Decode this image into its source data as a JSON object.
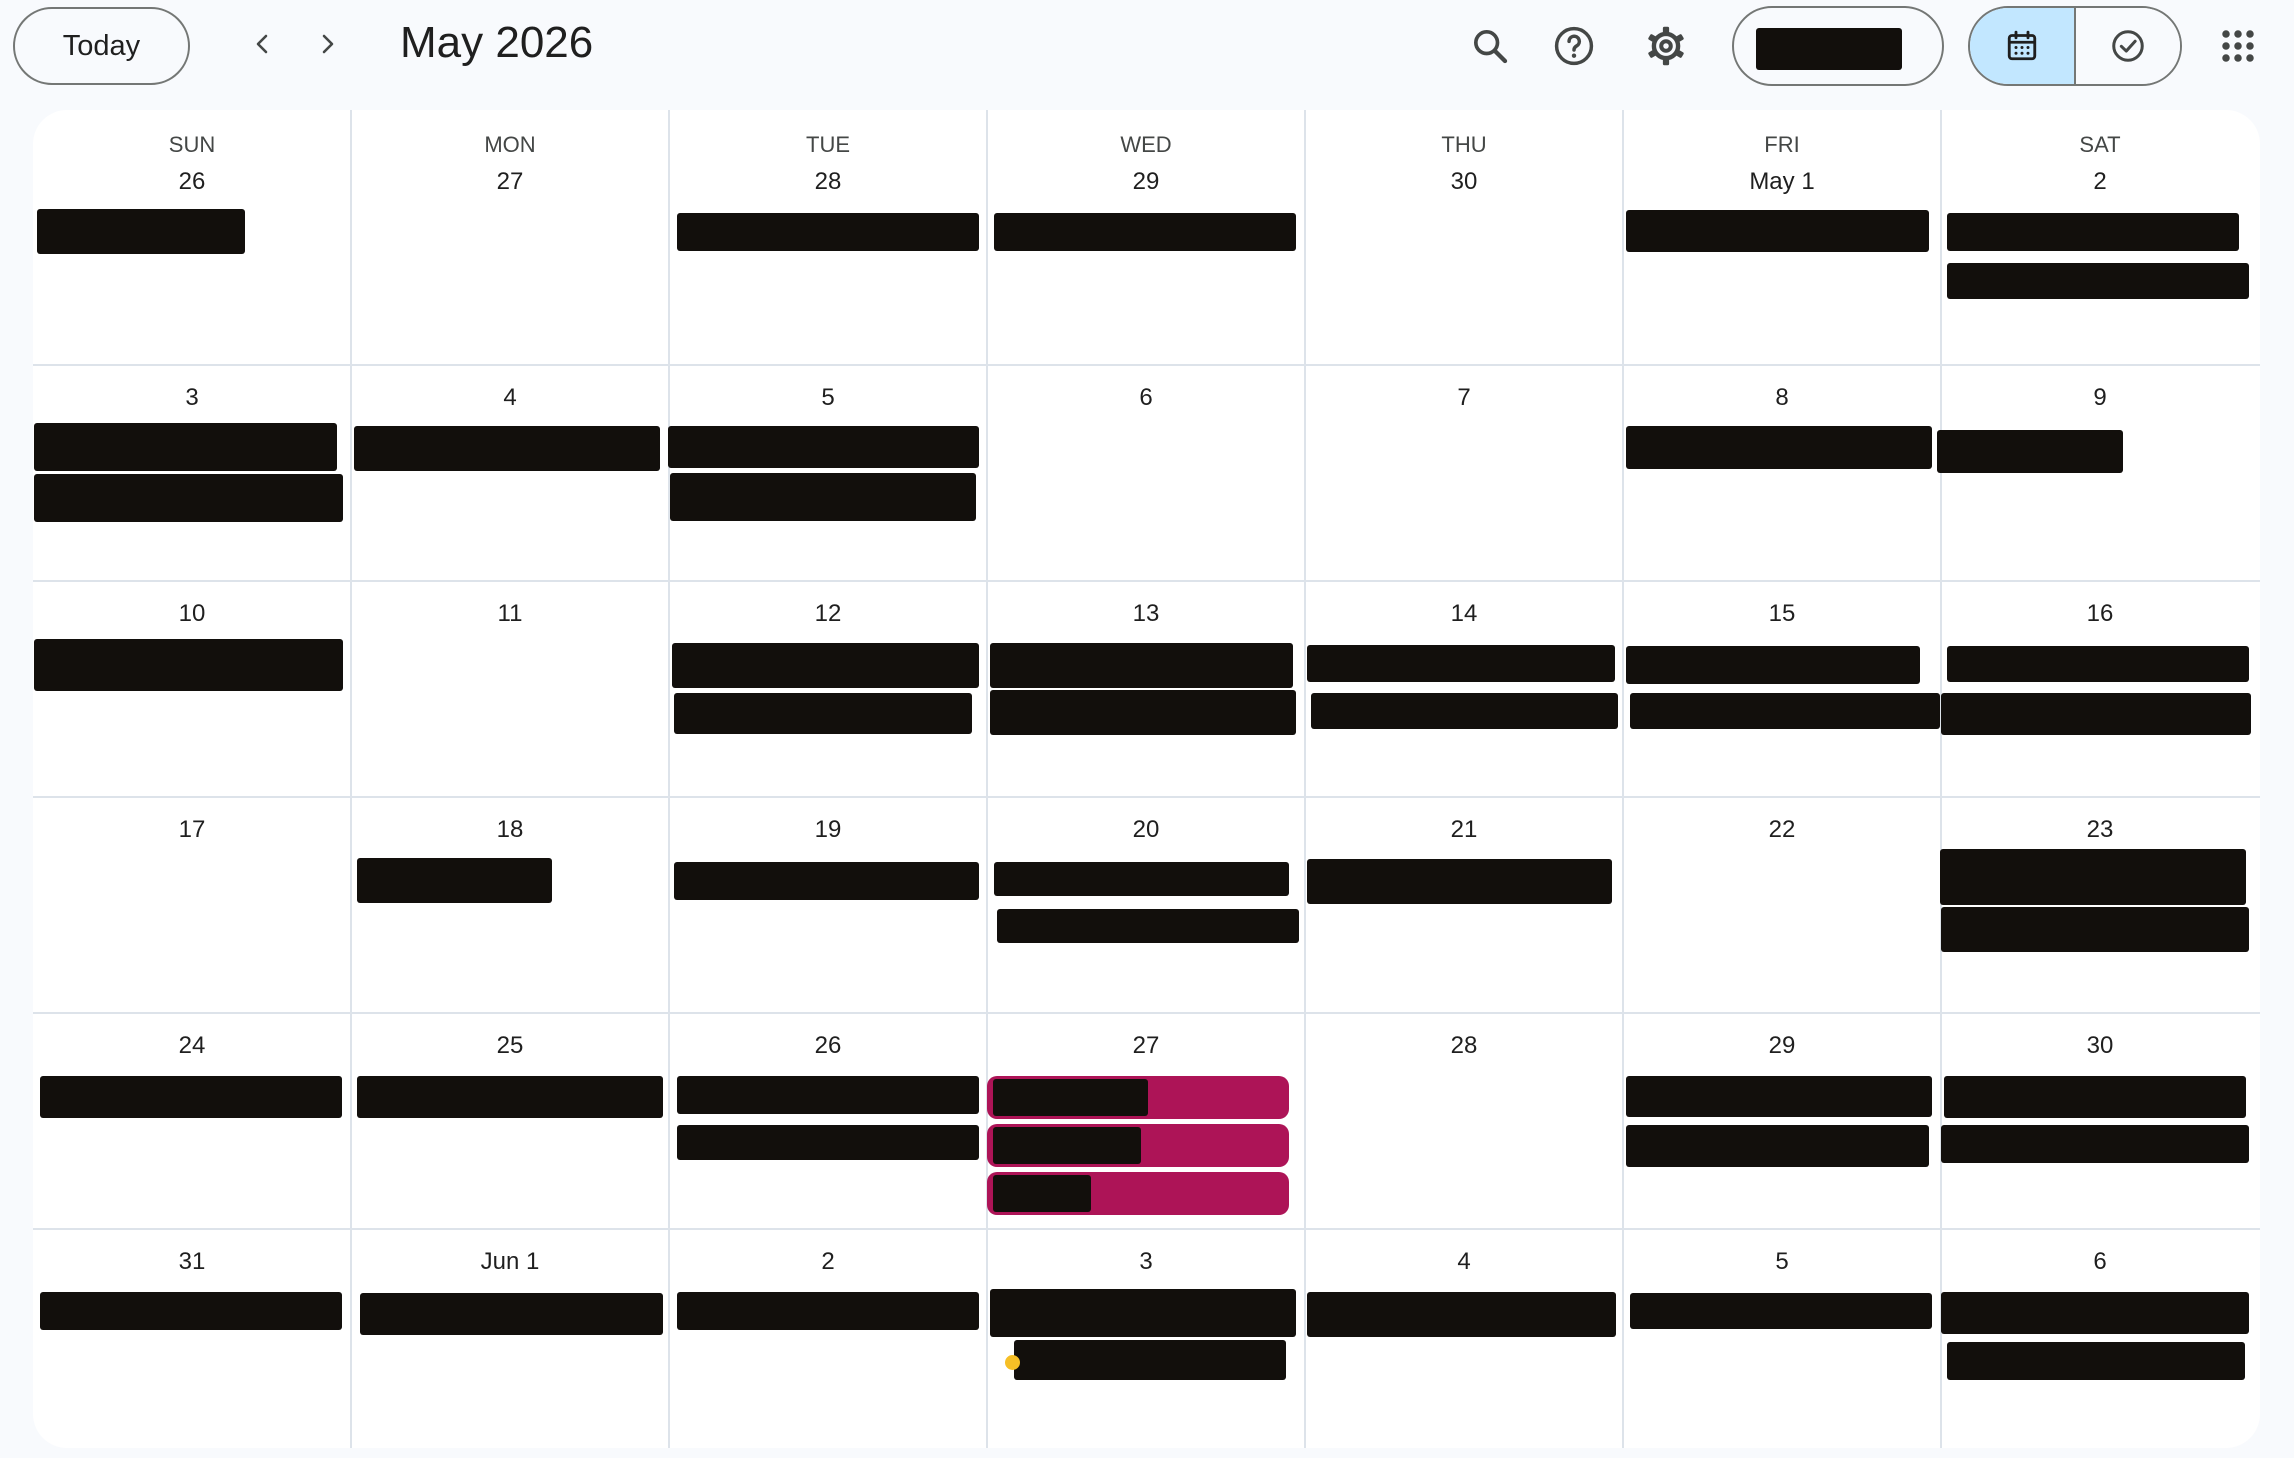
{
  "toolbar": {
    "today_label": "Today",
    "prev_label": "‹",
    "next_label": "›",
    "month_title": "May 2026"
  },
  "days_of_week": [
    "SUN",
    "MON",
    "TUE",
    "WED",
    "THU",
    "FRI",
    "SAT"
  ],
  "weeks": [
    [
      "26",
      "27",
      "28",
      "29",
      "30",
      "May 1",
      "2"
    ],
    [
      "3",
      "4",
      "5",
      "6",
      "7",
      "8",
      "9"
    ],
    [
      "10",
      "11",
      "12",
      "13",
      "14",
      "15",
      "16"
    ],
    [
      "17",
      "18",
      "19",
      "20",
      "21",
      "22",
      "23"
    ],
    [
      "24",
      "25",
      "26",
      "27",
      "28",
      "29",
      "30"
    ],
    [
      "31",
      "Jun 1",
      "2",
      "3",
      "4",
      "5",
      "6"
    ]
  ],
  "colors": {
    "accent_event": "#ad1457",
    "task_dot": "#f6bf26",
    "active_view": "#c2e7ff"
  },
  "icons": [
    "search-icon",
    "help-icon",
    "settings-icon",
    "calendar-icon",
    "task-check-icon",
    "apps-grid-icon"
  ]
}
